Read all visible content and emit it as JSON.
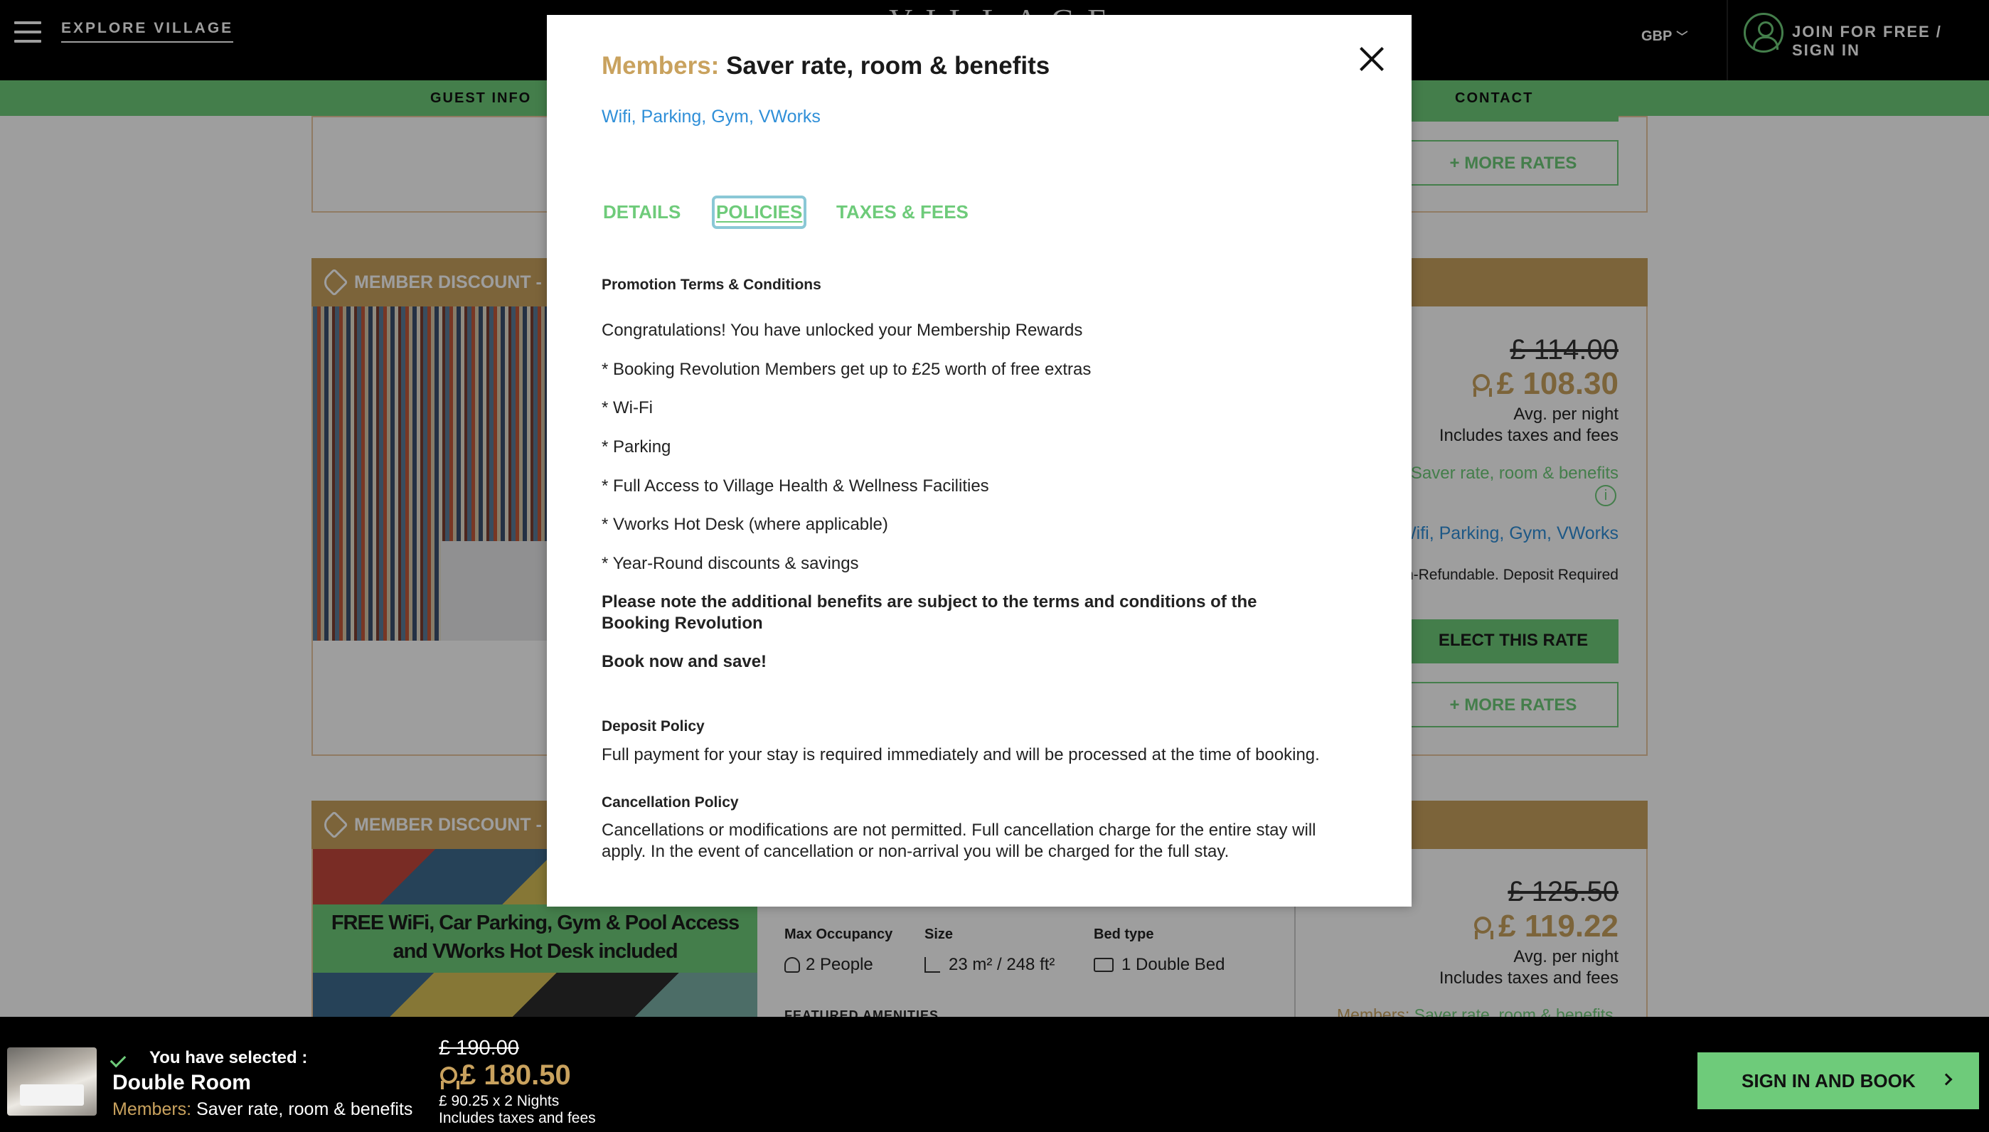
{
  "header": {
    "explore": "EXPLORE VILLAGE",
    "brand": "VILLAGE",
    "currency": "GBP",
    "join": "JOIN FOR FREE / SIGN IN"
  },
  "nav": {
    "guest_info": "GUEST INFO",
    "contact": "CONTACT"
  },
  "listing": {
    "more_rates": "+ MORE RATES",
    "banner": "MEMBER DISCOUNT - FR",
    "card2": {
      "old_price": "£ 114.00",
      "new_price": "£ 108.30",
      "avg": "Avg. per night",
      "includes": "Includes taxes and fees",
      "rate": "Saver rate, room & benefits",
      "perks": "Wifi, Parking, Gym, VWorks",
      "refund": "n-Refundable. Deposit Required",
      "select": "ELECT THIS RATE",
      "more_rates": "+ MORE RATES"
    },
    "card3": {
      "band": "FREE WiFi, Car Parking, Gym & Pool Access and VWorks Hot Desk included",
      "old_price": "£ 125.50",
      "new_price": "£ 119.22",
      "avg": "Avg. per night",
      "includes": "Includes taxes and fees",
      "members_prefix": "Members: ",
      "members_rate": "Saver rate, room & benefits",
      "max_occupancy_label": "Max Occupancy",
      "max_occupancy": "2 People",
      "size_label": "Size",
      "size": "23 m² / 248 ft²",
      "bed_label": "Bed type",
      "bed": "1 Double Bed",
      "amenities": "FEATURED AMENITIES"
    }
  },
  "modal": {
    "title_prefix": "Members:",
    "title": "Saver rate, room & benefits",
    "perks": "Wifi, Parking, Gym, VWorks",
    "tabs": [
      "DETAILS",
      "POLICIES",
      "TAXES & FEES"
    ],
    "promo_heading": "Promotion Terms & Conditions",
    "promo_lines": [
      "Congratulations! You have unlocked your Membership Rewards",
      "* Booking Revolution Members get up to £25 worth of free extras",
      "* Wi-Fi",
      "* Parking",
      "* Full Access to Village Health & Wellness Facilities",
      "* Vworks Hot Desk (where applicable)",
      "* Year-Round discounts & savings"
    ],
    "promo_note": "Please note the additional benefits are subject to the terms and conditions of the Booking Revolution",
    "promo_cta": "Book now and save!",
    "deposit_heading": "Deposit Policy",
    "deposit_text": "Full payment for your stay is required immediately and will be processed at the time of booking.",
    "cancel_heading": "Cancellation Policy",
    "cancel_text": "Cancellations or modifications are not permitted. Full cancellation charge for the entire stay will apply. In the event of cancellation or non-arrival you will be charged for the full stay."
  },
  "bottom": {
    "selected_label": "You have selected :",
    "room": "Double Room",
    "rate_prefix": "Members:",
    "rate": "Saver rate, room & benefits",
    "old_price": "£ 190.00",
    "new_price": "£ 180.50",
    "breakdown": "£ 90.25 x 2 Nights",
    "includes": "Includes taxes and fees",
    "cta": "SIGN IN AND BOOK"
  },
  "colors": {
    "accent_green": "#6ecb7a",
    "gold": "#c9a25e",
    "link_blue": "#2f8fd8"
  }
}
